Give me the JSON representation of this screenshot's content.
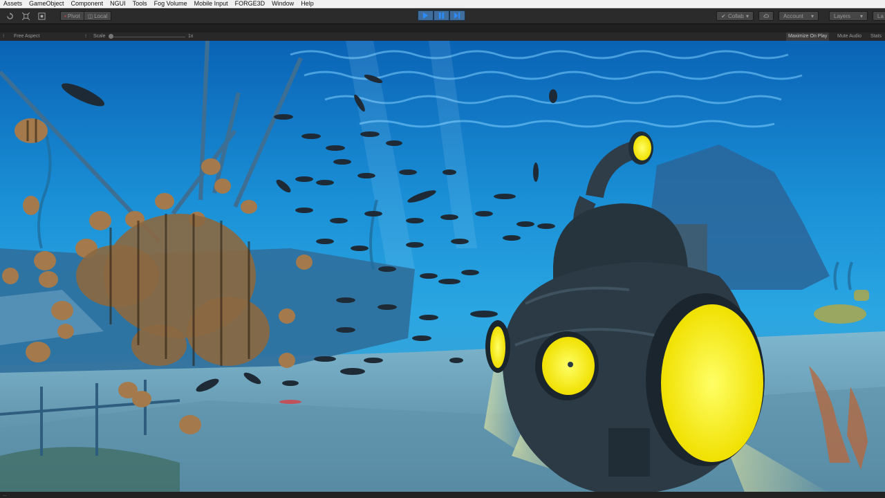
{
  "menu": [
    "Assets",
    "GameObject",
    "Component",
    "NGUI",
    "Tools",
    "Fog Volume",
    "Mobile Input",
    "FORGE3D",
    "Window",
    "Help"
  ],
  "toolbar": {
    "pivot_label": "Pivot",
    "local_label": "Local",
    "collab_label": "Collab",
    "account_label": "Account",
    "layers_label": "Layers",
    "layout_label": "La"
  },
  "game_view": {
    "aspect_label": "Free Aspect",
    "scale_label": "Scale",
    "scale_value": "1x",
    "maximize_label": "Maximize On Play",
    "mute_label": "Mute Audio",
    "stats_label": "Stats"
  },
  "status_text": "...",
  "colors": {
    "play_accent": "#3f6e9e",
    "water": "#1a8fd6",
    "sub_light": "#fff200"
  }
}
